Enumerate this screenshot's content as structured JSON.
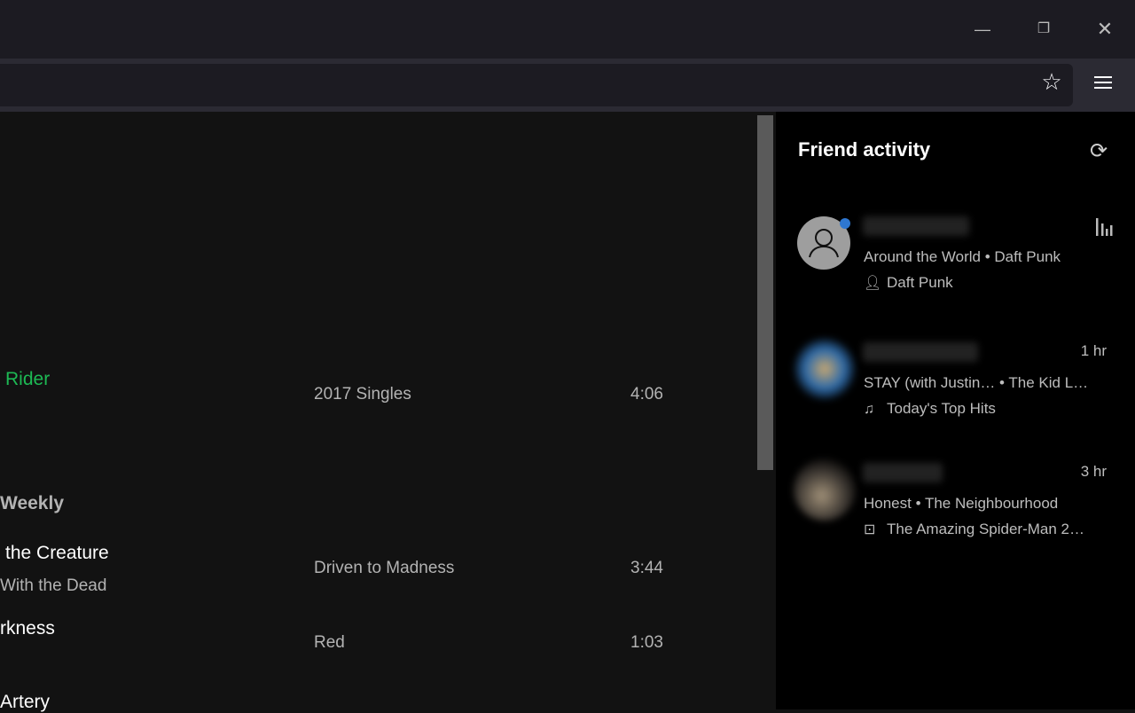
{
  "window": {
    "minimize_icon": "minimize",
    "restore_icon": "restore",
    "close_icon": "close"
  },
  "toolbar": {
    "bookmark_icon": "star",
    "menu_icon": "hamburger"
  },
  "tracks": [
    {
      "title": "Rider",
      "album": "2017 Singles",
      "duration": "4:06",
      "title_color": "#1db954"
    },
    {
      "section": "Weekly"
    },
    {
      "title": "the Creature",
      "artist": "With the Dead",
      "album": "Driven to Madness",
      "duration": "3:44"
    },
    {
      "title": "rkness",
      "album": "Red",
      "duration": "1:03"
    },
    {
      "title": "Artery"
    }
  ],
  "friend_activity": {
    "title": "Friend activity",
    "refresh_icon": "refresh",
    "friends": [
      {
        "track": "Around the World • Daft Punk",
        "context": "Daft Punk",
        "context_icon": "artist",
        "status": "now-playing",
        "online_dot_color": "#2e77d0"
      },
      {
        "track": "STAY (with Justin… • The Kid L…",
        "context": "Today's Top Hits",
        "context_icon": "playlist",
        "time": "1 hr"
      },
      {
        "track": "Honest • The Neighbourhood",
        "context": "The Amazing Spider-Man 2…",
        "context_icon": "album",
        "time": "3 hr"
      }
    ]
  }
}
